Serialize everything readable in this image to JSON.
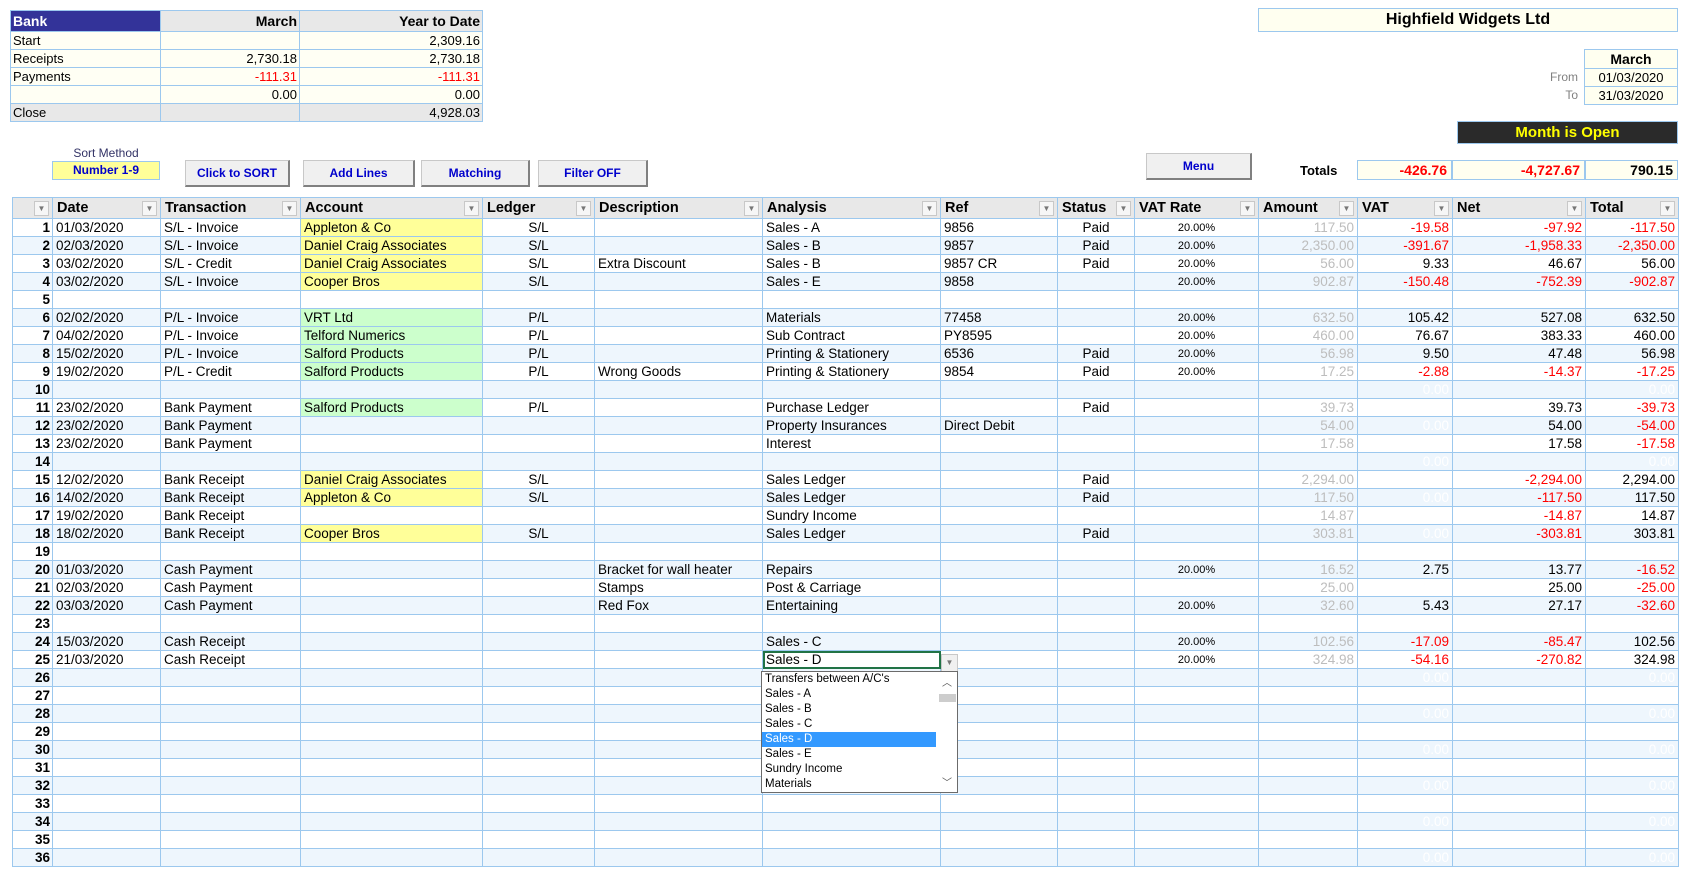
{
  "bank": {
    "headers": [
      "Bank",
      "March",
      "Year to Date"
    ],
    "rows": [
      {
        "label": "Start",
        "month": "",
        "ytd": "2,309.16",
        "month_neg": false,
        "ytd_neg": false
      },
      {
        "label": "Receipts",
        "month": "2,730.18",
        "ytd": "2,730.18",
        "month_neg": false,
        "ytd_neg": false
      },
      {
        "label": "Payments",
        "month": "-111.31",
        "ytd": "-111.31",
        "month_neg": true,
        "ytd_neg": true
      },
      {
        "label": "",
        "month": "0.00",
        "ytd": "0.00",
        "month_neg": false,
        "ytd_neg": false
      }
    ],
    "close": {
      "label": "Close",
      "month": "",
      "ytd": "4,928.03"
    }
  },
  "sort": {
    "label": "Sort Method",
    "value": "Number  1-9"
  },
  "toolbar": {
    "sort_button": "Click to SORT",
    "add_lines_button": "Add Lines",
    "matching_button": "Matching",
    "filter_button": "Filter OFF",
    "menu_button": "Menu"
  },
  "company": "Highfield Widgets Ltd",
  "period": {
    "month": "March",
    "from_label": "From",
    "from": "01/03/2020",
    "to_label": "To",
    "to": "31/03/2020"
  },
  "status_banner": "Month  is  Open",
  "totals": {
    "label": "Totals",
    "vat": "-426.76",
    "net": "-4,727.67",
    "total": "790.15"
  },
  "colors": {
    "negative": "#ff0000",
    "sales_ledger": "#ffff99",
    "purchase_ledger": "#ccffcc",
    "header_bank": "#333399",
    "banner_text": "#ffff00"
  },
  "grid": {
    "columns": [
      "Date",
      "Transaction",
      "Account",
      "Ledger",
      "Description",
      "Analysis",
      "Ref",
      "Status",
      "VAT Rate",
      "Amount",
      "VAT",
      "Net",
      "Total"
    ],
    "rows": [
      {
        "n": "1",
        "date": "01/03/2020",
        "tx": "S/L - Invoice",
        "acct": "Appleton & Co",
        "ledger": "S/L",
        "desc": "",
        "analysis": "Sales - A",
        "ref": "9856",
        "status": "Paid",
        "vatrate": "20.00%",
        "amount": "117.50",
        "vat": "-19.58",
        "net": "-97.92",
        "total": "-117.50"
      },
      {
        "n": "2",
        "date": "02/03/2020",
        "tx": "S/L - Invoice",
        "acct": "Daniel Craig Associates",
        "ledger": "S/L",
        "desc": "",
        "analysis": "Sales - B",
        "ref": "9857",
        "status": "Paid",
        "vatrate": "20.00%",
        "amount": "2,350.00",
        "vat": "-391.67",
        "net": "-1,958.33",
        "total": "-2,350.00"
      },
      {
        "n": "3",
        "date": "03/02/2020",
        "tx": "S/L - Credit",
        "acct": "Daniel Craig Associates",
        "ledger": "S/L",
        "desc": "Extra Discount",
        "analysis": "Sales - B",
        "ref": "9857 CR",
        "status": "Paid",
        "vatrate": "20.00%",
        "amount": "56.00",
        "vat": "9.33",
        "net": "46.67",
        "total": "56.00"
      },
      {
        "n": "4",
        "date": "03/02/2020",
        "tx": "S/L - Invoice",
        "acct": "Cooper Bros",
        "ledger": "S/L",
        "desc": "",
        "analysis": "Sales - E",
        "ref": "9858",
        "status": "",
        "vatrate": "20.00%",
        "amount": "902.87",
        "vat": "-150.48",
        "net": "-752.39",
        "total": "-902.87"
      },
      {
        "n": "5",
        "date": "",
        "tx": "",
        "acct": "",
        "ledger": "",
        "desc": "",
        "analysis": "",
        "ref": "",
        "status": "",
        "vatrate": "",
        "amount": "",
        "vat": "",
        "net": "",
        "total": ""
      },
      {
        "n": "6",
        "date": "02/02/2020",
        "tx": "P/L - Invoice",
        "acct": "VRT Ltd",
        "ledger": "P/L",
        "desc": "",
        "analysis": "Materials",
        "ref": "77458",
        "status": "",
        "vatrate": "20.00%",
        "amount": "632.50",
        "vat": "105.42",
        "net": "527.08",
        "total": "632.50"
      },
      {
        "n": "7",
        "date": "04/02/2020",
        "tx": "P/L - Invoice",
        "acct": "Telford Numerics",
        "ledger": "P/L",
        "desc": "",
        "analysis": "Sub Contract",
        "ref": "PY8595",
        "status": "",
        "vatrate": "20.00%",
        "amount": "460.00",
        "vat": "76.67",
        "net": "383.33",
        "total": "460.00"
      },
      {
        "n": "8",
        "date": "15/02/2020",
        "tx": "P/L - Invoice",
        "acct": "Salford Products",
        "ledger": "P/L",
        "desc": "",
        "analysis": "Printing & Stationery",
        "ref": "6536",
        "status": "Paid",
        "vatrate": "20.00%",
        "amount": "56.98",
        "vat": "9.50",
        "net": "47.48",
        "total": "56.98"
      },
      {
        "n": "9",
        "date": "19/02/2020",
        "tx": "P/L - Credit",
        "acct": "Salford Products",
        "ledger": "P/L",
        "desc": "Wrong Goods",
        "analysis": "Printing & Stationery",
        "ref": "9854",
        "status": "Paid",
        "vatrate": "20.00%",
        "amount": "17.25",
        "vat": "-2.88",
        "net": "-14.37",
        "total": "-17.25"
      },
      {
        "n": "10",
        "date": "",
        "tx": "",
        "acct": "",
        "ledger": "",
        "desc": "",
        "analysis": "",
        "ref": "",
        "status": "",
        "vatrate": "",
        "amount": "",
        "vat": "0.00",
        "net": "",
        "total": "0.00"
      },
      {
        "n": "11",
        "date": "23/02/2020",
        "tx": "Bank Payment",
        "acct": "Salford Products",
        "ledger": "P/L",
        "desc": "",
        "analysis": "Purchase Ledger",
        "ref": "",
        "status": "Paid",
        "vatrate": "",
        "amount": "39.73",
        "vat": "",
        "net": "39.73",
        "total": "-39.73"
      },
      {
        "n": "12",
        "date": "23/02/2020",
        "tx": "Bank Payment",
        "acct": "",
        "ledger": "",
        "desc": "",
        "analysis": "Property Insurances",
        "ref": "Direct Debit",
        "status": "",
        "vatrate": "",
        "amount": "54.00",
        "vat": "0.00",
        "net": "54.00",
        "total": "-54.00"
      },
      {
        "n": "13",
        "date": "23/02/2020",
        "tx": "Bank Payment",
        "acct": "",
        "ledger": "",
        "desc": "",
        "analysis": "Interest",
        "ref": "",
        "status": "",
        "vatrate": "",
        "amount": "17.58",
        "vat": "",
        "net": "17.58",
        "total": "-17.58"
      },
      {
        "n": "14",
        "date": "",
        "tx": "",
        "acct": "",
        "ledger": "",
        "desc": "",
        "analysis": "",
        "ref": "",
        "status": "",
        "vatrate": "",
        "amount": "",
        "vat": "0.00",
        "net": "",
        "total": "0.00"
      },
      {
        "n": "15",
        "date": "12/02/2020",
        "tx": "Bank Receipt",
        "acct": "Daniel Craig Associates",
        "ledger": "S/L",
        "desc": "",
        "analysis": "Sales Ledger",
        "ref": "",
        "status": "Paid",
        "vatrate": "",
        "amount": "2,294.00",
        "vat": "",
        "net": "-2,294.00",
        "total": "2,294.00"
      },
      {
        "n": "16",
        "date": "14/02/2020",
        "tx": "Bank Receipt",
        "acct": "Appleton & Co",
        "ledger": "S/L",
        "desc": "",
        "analysis": "Sales Ledger",
        "ref": "",
        "status": "Paid",
        "vatrate": "",
        "amount": "117.50",
        "vat": "0.00",
        "net": "-117.50",
        "total": "117.50"
      },
      {
        "n": "17",
        "date": "19/02/2020",
        "tx": "Bank Receipt",
        "acct": "",
        "ledger": "",
        "desc": "",
        "analysis": "Sundry Income",
        "ref": "",
        "status": "",
        "vatrate": "",
        "amount": "14.87",
        "vat": "",
        "net": "-14.87",
        "total": "14.87"
      },
      {
        "n": "18",
        "date": "18/02/2020",
        "tx": "Bank Receipt",
        "acct": "Cooper Bros",
        "ledger": "S/L",
        "desc": "",
        "analysis": "Sales Ledger",
        "ref": "",
        "status": "Paid",
        "vatrate": "",
        "amount": "303.81",
        "vat": "0.00",
        "net": "-303.81",
        "total": "303.81"
      },
      {
        "n": "19",
        "date": "",
        "tx": "",
        "acct": "",
        "ledger": "",
        "desc": "",
        "analysis": "",
        "ref": "",
        "status": "",
        "vatrate": "",
        "amount": "",
        "vat": "",
        "net": "",
        "total": ""
      },
      {
        "n": "20",
        "date": "01/03/2020",
        "tx": "Cash Payment",
        "acct": "",
        "ledger": "",
        "desc": "Bracket for wall heater",
        "analysis": "Repairs",
        "ref": "",
        "status": "",
        "vatrate": "20.00%",
        "amount": "16.52",
        "vat": "2.75",
        "net": "13.77",
        "total": "-16.52"
      },
      {
        "n": "21",
        "date": "02/03/2020",
        "tx": "Cash Payment",
        "acct": "",
        "ledger": "",
        "desc": "Stamps",
        "analysis": "Post & Carriage",
        "ref": "",
        "status": "",
        "vatrate": "",
        "amount": "25.00",
        "vat": "",
        "net": "25.00",
        "total": "-25.00"
      },
      {
        "n": "22",
        "date": "03/03/2020",
        "tx": "Cash Payment",
        "acct": "",
        "ledger": "",
        "desc": "Red Fox",
        "analysis": "Entertaining",
        "ref": "",
        "status": "",
        "vatrate": "20.00%",
        "amount": "32.60",
        "vat": "5.43",
        "net": "27.17",
        "total": "-32.60"
      },
      {
        "n": "23",
        "date": "",
        "tx": "",
        "acct": "",
        "ledger": "",
        "desc": "",
        "analysis": "",
        "ref": "",
        "status": "",
        "vatrate": "",
        "amount": "",
        "vat": "",
        "net": "",
        "total": ""
      },
      {
        "n": "24",
        "date": "15/03/2020",
        "tx": "Cash Receipt",
        "acct": "",
        "ledger": "",
        "desc": "",
        "analysis": "Sales - C",
        "ref": "",
        "status": "",
        "vatrate": "20.00%",
        "amount": "102.56",
        "vat": "-17.09",
        "net": "-85.47",
        "total": "102.56"
      },
      {
        "n": "25",
        "date": "21/03/2020",
        "tx": "Cash Receipt",
        "acct": "",
        "ledger": "",
        "desc": "",
        "analysis": "Sales - D",
        "ref": "",
        "status": "",
        "vatrate": "20.00%",
        "amount": "324.98",
        "vat": "-54.16",
        "net": "-270.82",
        "total": "324.98"
      },
      {
        "n": "26",
        "date": "",
        "tx": "",
        "acct": "",
        "ledger": "",
        "desc": "",
        "analysis": "",
        "ref": "",
        "status": "",
        "vatrate": "",
        "amount": "",
        "vat": "0.00",
        "net": "",
        "total": "0.00"
      },
      {
        "n": "27",
        "date": "",
        "tx": "",
        "acct": "",
        "ledger": "",
        "desc": "",
        "analysis": "",
        "ref": "",
        "status": "",
        "vatrate": "",
        "amount": "",
        "vat": "",
        "net": "",
        "total": ""
      },
      {
        "n": "28",
        "date": "",
        "tx": "",
        "acct": "",
        "ledger": "",
        "desc": "",
        "analysis": "",
        "ref": "",
        "status": "",
        "vatrate": "",
        "amount": "",
        "vat": "0.00",
        "net": "",
        "total": "0.00"
      },
      {
        "n": "29",
        "date": "",
        "tx": "",
        "acct": "",
        "ledger": "",
        "desc": "",
        "analysis": "",
        "ref": "",
        "status": "",
        "vatrate": "",
        "amount": "",
        "vat": "",
        "net": "",
        "total": ""
      },
      {
        "n": "30",
        "date": "",
        "tx": "",
        "acct": "",
        "ledger": "",
        "desc": "",
        "analysis": "",
        "ref": "",
        "status": "",
        "vatrate": "",
        "amount": "",
        "vat": "0.00",
        "net": "",
        "total": "0.00"
      },
      {
        "n": "31",
        "date": "",
        "tx": "",
        "acct": "",
        "ledger": "",
        "desc": "",
        "analysis": "",
        "ref": "",
        "status": "",
        "vatrate": "",
        "amount": "",
        "vat": "",
        "net": "",
        "total": ""
      },
      {
        "n": "32",
        "date": "",
        "tx": "",
        "acct": "",
        "ledger": "",
        "desc": "",
        "analysis": "",
        "ref": "",
        "status": "",
        "vatrate": "",
        "amount": "",
        "vat": "0.00",
        "net": "",
        "total": "0.00"
      },
      {
        "n": "33",
        "date": "",
        "tx": "",
        "acct": "",
        "ledger": "",
        "desc": "",
        "analysis": "",
        "ref": "",
        "status": "",
        "vatrate": "",
        "amount": "",
        "vat": "",
        "net": "",
        "total": ""
      },
      {
        "n": "34",
        "date": "",
        "tx": "",
        "acct": "",
        "ledger": "",
        "desc": "",
        "analysis": "",
        "ref": "",
        "status": "",
        "vatrate": "",
        "amount": "",
        "vat": "0.00",
        "net": "",
        "total": "0.00"
      },
      {
        "n": "35",
        "date": "",
        "tx": "",
        "acct": "",
        "ledger": "",
        "desc": "",
        "analysis": "",
        "ref": "",
        "status": "",
        "vatrate": "",
        "amount": "",
        "vat": "",
        "net": "",
        "total": ""
      },
      {
        "n": "36",
        "date": "",
        "tx": "",
        "acct": "",
        "ledger": "",
        "desc": "",
        "analysis": "",
        "ref": "",
        "status": "",
        "vatrate": "",
        "amount": "",
        "vat": "0.00",
        "net": "",
        "total": "0.00"
      }
    ]
  },
  "dropdown": {
    "selected": "Sales - D",
    "options": [
      "Transfers between A/C's",
      "Sales - A",
      "Sales - B",
      "Sales - C",
      "Sales - D",
      "Sales - E",
      "Sundry Income",
      "Materials"
    ]
  }
}
